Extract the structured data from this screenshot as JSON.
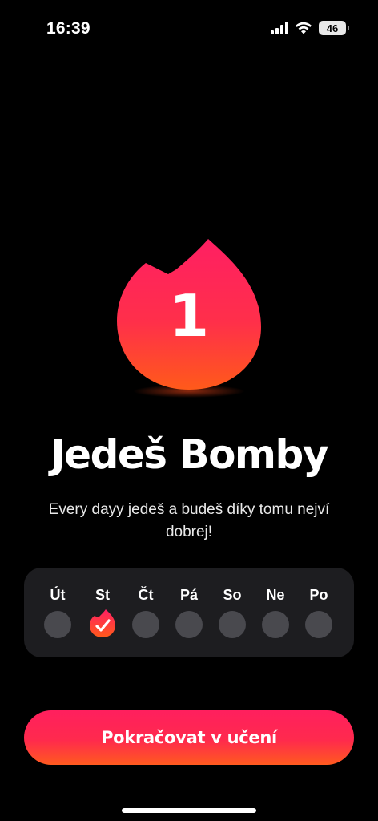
{
  "status_bar": {
    "time": "16:39",
    "battery": "46",
    "icons": [
      "signal-icon",
      "wifi-icon",
      "battery-icon"
    ]
  },
  "streak": {
    "count": "1",
    "icon": "flame-icon"
  },
  "title": "Jedeš Bomby",
  "subtitle": "Every dayy jedeš a budeš díky tomu nejví dobrej!",
  "week": {
    "days": [
      {
        "label": "Út",
        "done": false
      },
      {
        "label": "St",
        "done": true
      },
      {
        "label": "Čt",
        "done": false
      },
      {
        "label": "Pá",
        "done": false
      },
      {
        "label": "So",
        "done": false
      },
      {
        "label": "Ne",
        "done": false
      },
      {
        "label": "Po",
        "done": false
      }
    ]
  },
  "cta": {
    "label": "Pokračovat v učení"
  },
  "colors": {
    "accent_top": "#ff1f5e",
    "accent_bottom": "#ff5a1f",
    "card_bg": "#1d1d20",
    "dot_inactive": "#49494e"
  }
}
